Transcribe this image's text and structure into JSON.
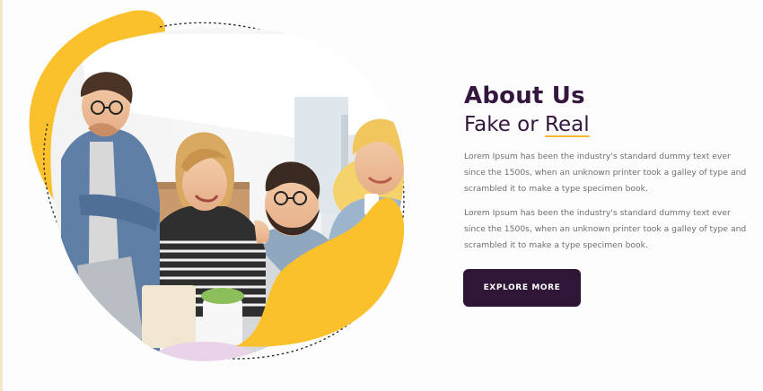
{
  "about": {
    "title": "About Us",
    "subtitle_prefix": "Fake or ",
    "subtitle_highlight": "Real",
    "paragraphs": [
      "Lorem Ipsum has been the industry's standard dummy text ever since the 1500s, when an unknown printer took a galley of type and scrambled it to make a type specimen book.",
      "Lorem Ipsum has been the industry's standard dummy text ever since the 1500s, when an unknown printer took a galley of type and scrambled it to make a type specimen book."
    ],
    "cta_label": "EXPLORE MORE"
  },
  "colors": {
    "accent_yellow": "#fbc12d",
    "brand_dark": "#34163f",
    "text_muted": "#6e6e6e"
  },
  "hero_image": {
    "subject": "team-photo"
  }
}
